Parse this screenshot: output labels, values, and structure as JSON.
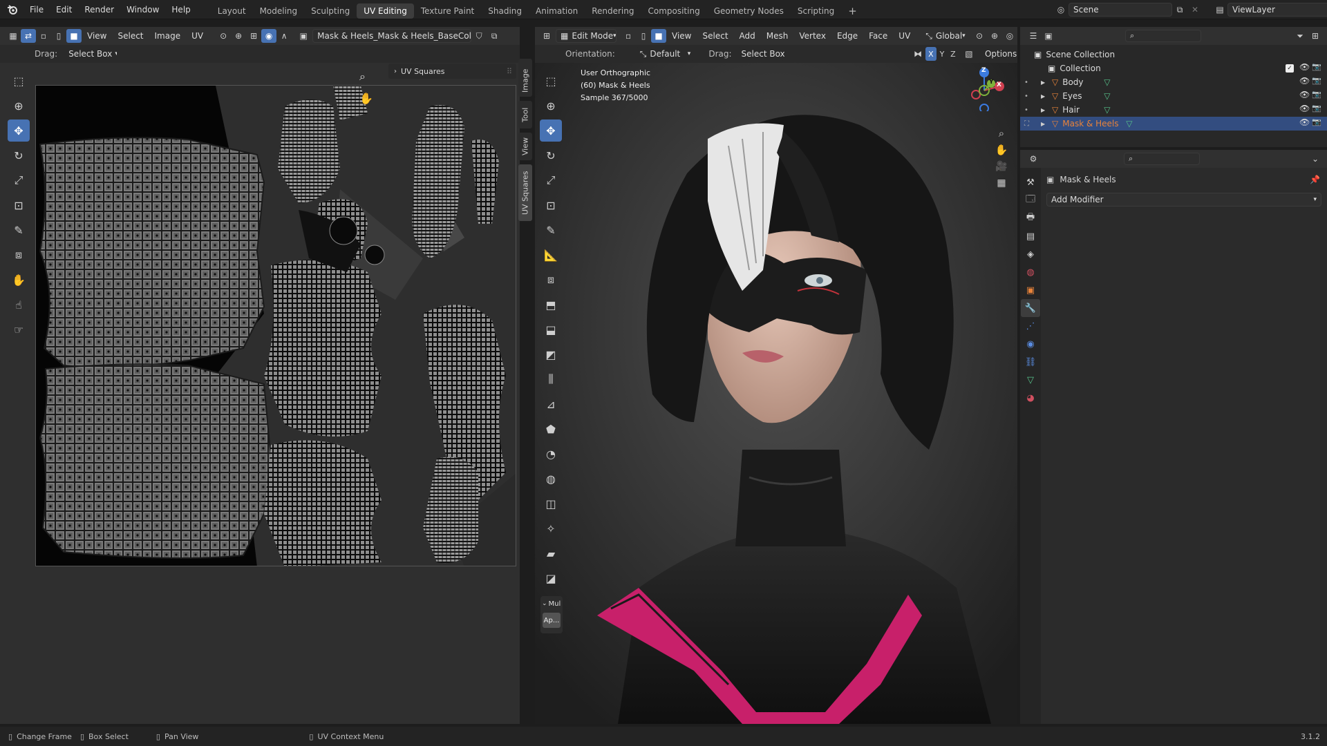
{
  "topbar": {
    "menus": [
      "File",
      "Edit",
      "Render",
      "Window",
      "Help"
    ],
    "workspaces": [
      "Layout",
      "Modeling",
      "Sculpting",
      "UV Editing",
      "Texture Paint",
      "Shading",
      "Animation",
      "Rendering",
      "Compositing",
      "Geometry Nodes",
      "Scripting"
    ],
    "active_workspace": "UV Editing",
    "add_tab": "+",
    "scene_label": "Scene",
    "viewlayer_label": "ViewLayer"
  },
  "uv_editor": {
    "menus": [
      "View",
      "Select",
      "Image",
      "UV"
    ],
    "image_name": "Mask & Heels_Mask & Heels_BaseColor.png",
    "drag_label": "Drag:",
    "drag_value": "Select Box",
    "panel_title": "UV Squares",
    "side_tabs": [
      "Image",
      "Tool",
      "View",
      "UV Squares"
    ]
  },
  "viewport": {
    "mode": "Edit Mode",
    "menus": [
      "View",
      "Select",
      "Add",
      "Mesh",
      "Vertex",
      "Edge",
      "Face",
      "UV"
    ],
    "transform": "Global",
    "orientation_label": "Orientation:",
    "orientation_value": "Default",
    "drag_label": "Drag:",
    "drag_value": "Select Box",
    "options_label": "Options",
    "axes": [
      "X",
      "Y",
      "Z"
    ],
    "info_view": "User Orthographic",
    "info_object": "(60) Mask & Heels",
    "info_sample": "Sample 367/5000",
    "gizmo_labels": {
      "z": "Z",
      "y": "Y",
      "x": "X"
    },
    "last_op": {
      "label": "Mul",
      "button": "Ap..."
    }
  },
  "outliner": {
    "root": "Scene Collection",
    "collection": "Collection",
    "items": [
      {
        "name": "Body",
        "selected": false
      },
      {
        "name": "Eyes",
        "selected": false
      },
      {
        "name": "Hair",
        "selected": false
      },
      {
        "name": "Mask & Heels",
        "selected": true
      }
    ]
  },
  "properties": {
    "object_name": "Mask & Heels",
    "add_modifier": "Add Modifier"
  },
  "statusbar": {
    "items": [
      "Change Frame",
      "Box Select",
      "Pan View",
      "UV Context Menu"
    ],
    "version": "3.1.2"
  },
  "colors": {
    "accent": "#4772b3",
    "selection": "#334d80",
    "object_orange": "#e8833a",
    "mesh_green": "#57c28a",
    "suit_magenta": "#c8206a"
  }
}
